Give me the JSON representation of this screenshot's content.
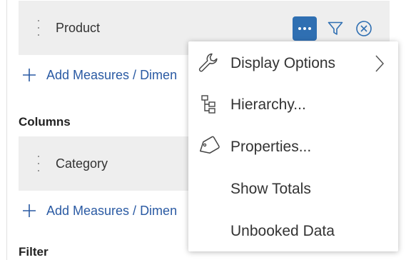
{
  "rows": {
    "product": {
      "label": "Product"
    },
    "category": {
      "label": "Category"
    }
  },
  "add_link_label": "Add Measures / Dimen",
  "sections": {
    "columns": "Columns",
    "filter": "Filter"
  },
  "icons": {
    "more": "more-horizontal-icon",
    "filter": "filter-icon",
    "remove": "circle-close-icon"
  },
  "context_menu": {
    "items": [
      {
        "label": "Display Options",
        "icon": "wrench-icon",
        "has_submenu": true
      },
      {
        "label": "Hierarchy...",
        "icon": "hierarchy-icon",
        "has_submenu": false
      },
      {
        "label": "Properties...",
        "icon": "tag-icon",
        "has_submenu": false
      },
      {
        "label": "Show Totals",
        "icon": "",
        "has_submenu": false
      },
      {
        "label": "Unbooked Data",
        "icon": "",
        "has_submenu": false
      }
    ]
  },
  "colors": {
    "accent": "#2f6fb2",
    "link": "#2a5aa3",
    "row_background": "#eeeeee"
  }
}
